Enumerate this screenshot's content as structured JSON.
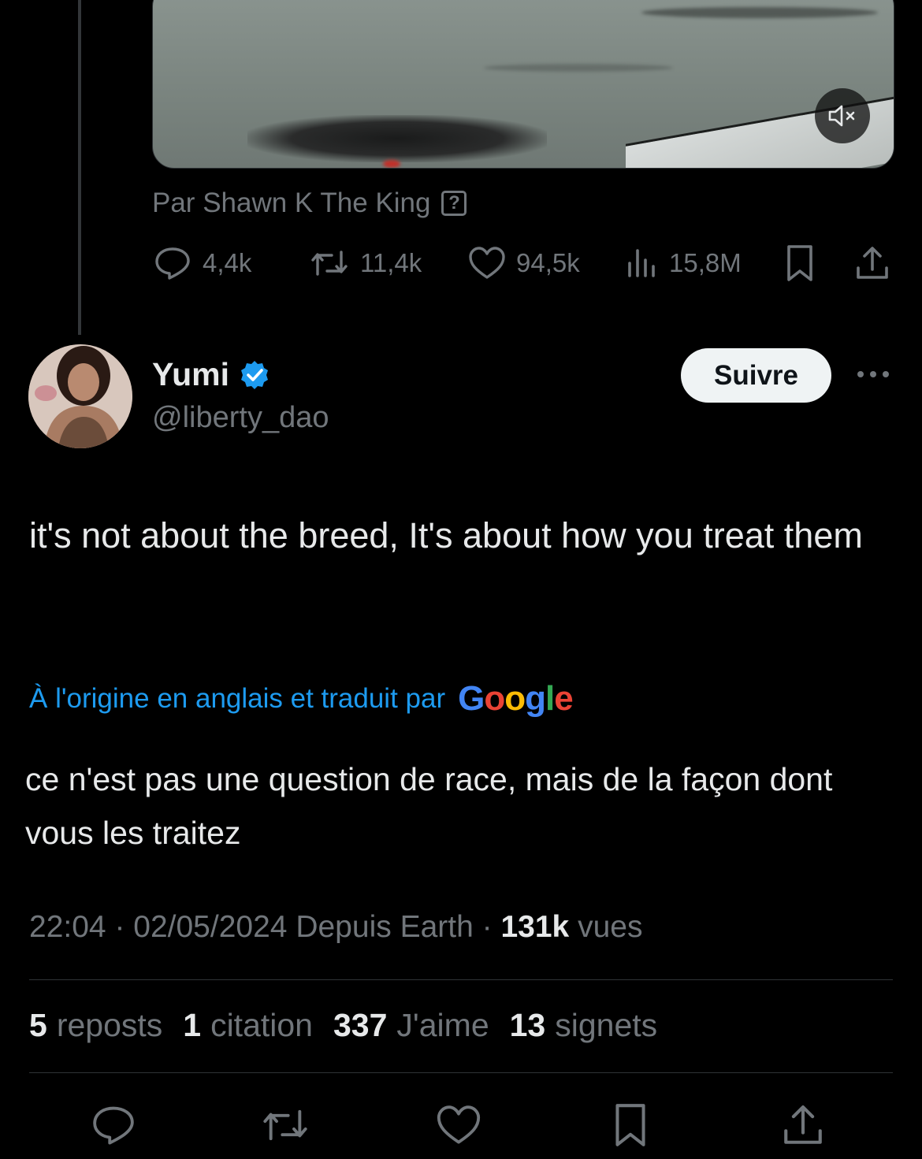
{
  "previous_tweet": {
    "media_attribution": "Par Shawn K The King",
    "stats": {
      "replies": "4,4k",
      "reposts": "11,4k",
      "likes": "94,5k",
      "views": "15,8M"
    }
  },
  "author": {
    "name": "Yumi",
    "handle": "@liberty_dao",
    "verified": true
  },
  "follow_label": "Suivre",
  "tweet": {
    "text": "it's not about the breed, It's about how you treat them",
    "translated_by_label": "À l'origine en anglais et traduit par",
    "translation_provider": "Google",
    "translation": "ce n'est pas une question de race, mais de la façon dont vous les traitez"
  },
  "meta": {
    "time": "22:04",
    "date": "02/05/2024",
    "location": "Depuis Earth",
    "views_count": "131k",
    "views_label": "vues"
  },
  "engagement": {
    "reposts_count": "5",
    "reposts_label": "reposts",
    "quotes_count": "1",
    "quotes_label": "citation",
    "likes_count": "337",
    "likes_label": "J'aime",
    "bookmarks_count": "13",
    "bookmarks_label": "signets"
  },
  "colors": {
    "background": "#000000",
    "text_primary": "#e7e9ea",
    "text_secondary": "#71767b",
    "accent_blue": "#1d9bf0",
    "divider": "#2f3336"
  }
}
